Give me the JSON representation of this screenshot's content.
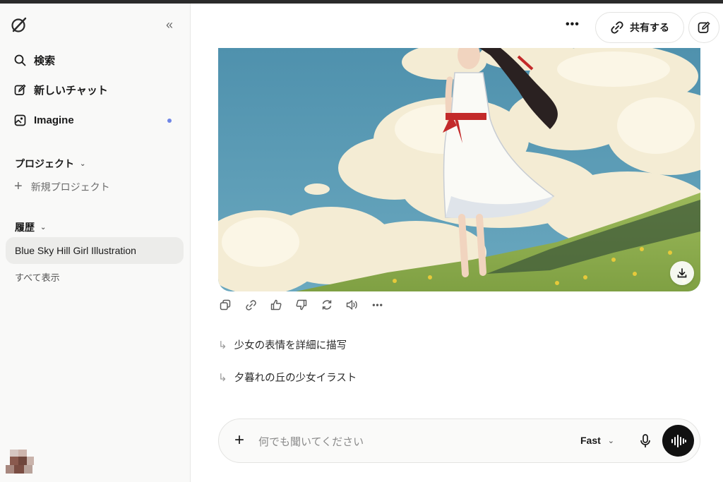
{
  "app": {
    "accent_dot_color": "#6f86e6"
  },
  "sidebar": {
    "nav": [
      {
        "label": "検索",
        "icon": "search-icon"
      },
      {
        "label": "新しいチャット",
        "icon": "edit-icon"
      },
      {
        "label": "Imagine",
        "icon": "image-icon",
        "has_dot": true
      }
    ],
    "projects_title": "プロジェクト",
    "new_project_label": "新規プロジェクト",
    "history_title": "履歴",
    "history_items": [
      {
        "label": "Blue Sky Hill Girl Illustration"
      }
    ],
    "show_all_label": "すべて表示"
  },
  "header": {
    "share_label": "共有する"
  },
  "main": {
    "suggestions": [
      {
        "label": "少女の表情を詳細に描写"
      },
      {
        "label": "夕暮れの丘の少女イラスト"
      }
    ]
  },
  "composer": {
    "placeholder": "何でも聞いてください",
    "mode_label": "Fast"
  }
}
